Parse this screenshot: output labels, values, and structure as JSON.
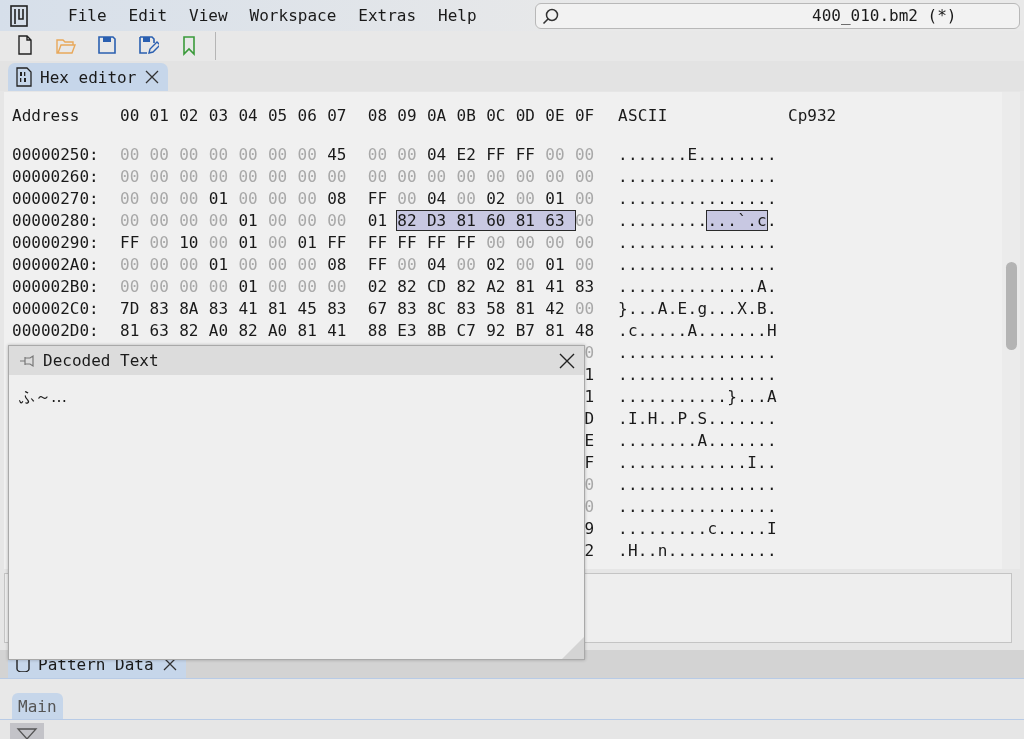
{
  "menu": [
    "File",
    "Edit",
    "View",
    "Workspace",
    "Extras",
    "Help"
  ],
  "title_field": {
    "value": "400_010.bm2 (*)"
  },
  "editor_tab": {
    "label": "Hex editor",
    "selected": true
  },
  "hex_editor": {
    "header": {
      "address": "Address",
      "columns": [
        "00",
        "01",
        "02",
        "03",
        "04",
        "05",
        "06",
        "07",
        "08",
        "09",
        "0A",
        "0B",
        "0C",
        "0D",
        "0E",
        "0F"
      ],
      "ascii": "ASCII",
      "encoding": "Cp932"
    },
    "rows": [
      {
        "address": "00000250:",
        "segments": [
          {
            "bytes": [
              "00",
              "00",
              "00",
              "00",
              "00",
              "00",
              "00",
              "45",
              "00",
              "00",
              "04",
              "E2",
              "FF",
              "FF",
              "00",
              "00"
            ],
            "ascii": ".......E........",
            "selected": false
          }
        ]
      },
      {
        "address": "00000260:",
        "segments": [
          {
            "bytes": [
              "00",
              "00",
              "00",
              "00",
              "00",
              "00",
              "00",
              "00",
              "00",
              "00",
              "00",
              "00",
              "00",
              "00",
              "00",
              "00"
            ],
            "ascii": "................",
            "selected": false
          }
        ]
      },
      {
        "address": "00000270:",
        "segments": [
          {
            "bytes": [
              "00",
              "00",
              "00",
              "01",
              "00",
              "00",
              "00",
              "08",
              "FF",
              "00",
              "04",
              "00",
              "02",
              "00",
              "01",
              "00"
            ],
            "ascii": "................",
            "selected": false
          }
        ]
      },
      {
        "address": "00000280:",
        "segments": [
          {
            "bytes": [
              "00",
              "00",
              "00",
              "00",
              "01",
              "00",
              "00",
              "00",
              "01"
            ],
            "ascii": ".........",
            "selected": false
          },
          {
            "bytes": [
              "82",
              "D3",
              "81",
              "60",
              "81",
              "63"
            ],
            "ascii": "...`.c",
            "selected": true
          },
          {
            "bytes": [
              "00"
            ],
            "ascii": ".",
            "selected": false
          }
        ]
      },
      {
        "address": "00000290:",
        "segments": [
          {
            "bytes": [
              "FF",
              "00",
              "10",
              "00",
              "01",
              "00",
              "01",
              "FF",
              "FF",
              "FF",
              "FF",
              "FF",
              "00",
              "00",
              "00",
              "00"
            ],
            "ascii": "................",
            "selected": false
          }
        ]
      },
      {
        "address": "000002A0:",
        "segments": [
          {
            "bytes": [
              "00",
              "00",
              "00",
              "01",
              "00",
              "00",
              "00",
              "08",
              "FF",
              "00",
              "04",
              "00",
              "02",
              "00",
              "01",
              "00"
            ],
            "ascii": "................",
            "selected": false
          }
        ]
      },
      {
        "address": "000002B0:",
        "segments": [
          {
            "bytes": [
              "00",
              "00",
              "00",
              "00",
              "01",
              "00",
              "00",
              "00",
              "02",
              "82",
              "CD",
              "82",
              "A2",
              "81",
              "41",
              "83"
            ],
            "ascii": "..............A.",
            "selected": false
          }
        ]
      },
      {
        "address": "000002C0:",
        "segments": [
          {
            "bytes": [
              "7D",
              "83",
              "8A",
              "83",
              "41",
              "81",
              "45",
              "83",
              "67",
              "83",
              "8C",
              "83",
              "58",
              "81",
              "42",
              "00"
            ],
            "ascii": "}...A.E.g...X.B.",
            "selected": false
          }
        ]
      },
      {
        "address": "000002D0:",
        "segments": [
          {
            "bytes": [
              "81",
              "63",
              "82",
              "A0",
              "82",
              "A0",
              "81",
              "41",
              "88",
              "E3",
              "8B",
              "C7",
              "92",
              "B7",
              "81",
              "48"
            ],
            "ascii": ".c.....A.......H",
            "selected": false
          }
        ]
      }
    ],
    "covered_rows": [
      {
        "last_digit": "0",
        "ascii": "................"
      },
      {
        "last_digit": "1",
        "ascii": "................"
      },
      {
        "last_digit": "1",
        "ascii": "...........}...A"
      },
      {
        "last_digit": "D",
        "ascii": ".I.H..P.S......."
      },
      {
        "last_digit": "E",
        "ascii": "........A......."
      },
      {
        "last_digit": "F",
        "ascii": ".............I.."
      },
      {
        "last_digit": "0",
        "ascii": "................"
      },
      {
        "last_digit": "0",
        "ascii": "................"
      },
      {
        "last_digit": "9",
        "ascii": ".........c.....I"
      },
      {
        "last_digit": "2",
        "ascii": ".H..n..........."
      }
    ]
  },
  "decoded_text_panel": {
    "title": "Decoded Text",
    "text": "ふ～…"
  },
  "pattern_data_tab": {
    "label": "Pattern Data",
    "selected": true
  },
  "pattern_subtabs": [
    {
      "label": "Main",
      "selected": true
    }
  ]
}
